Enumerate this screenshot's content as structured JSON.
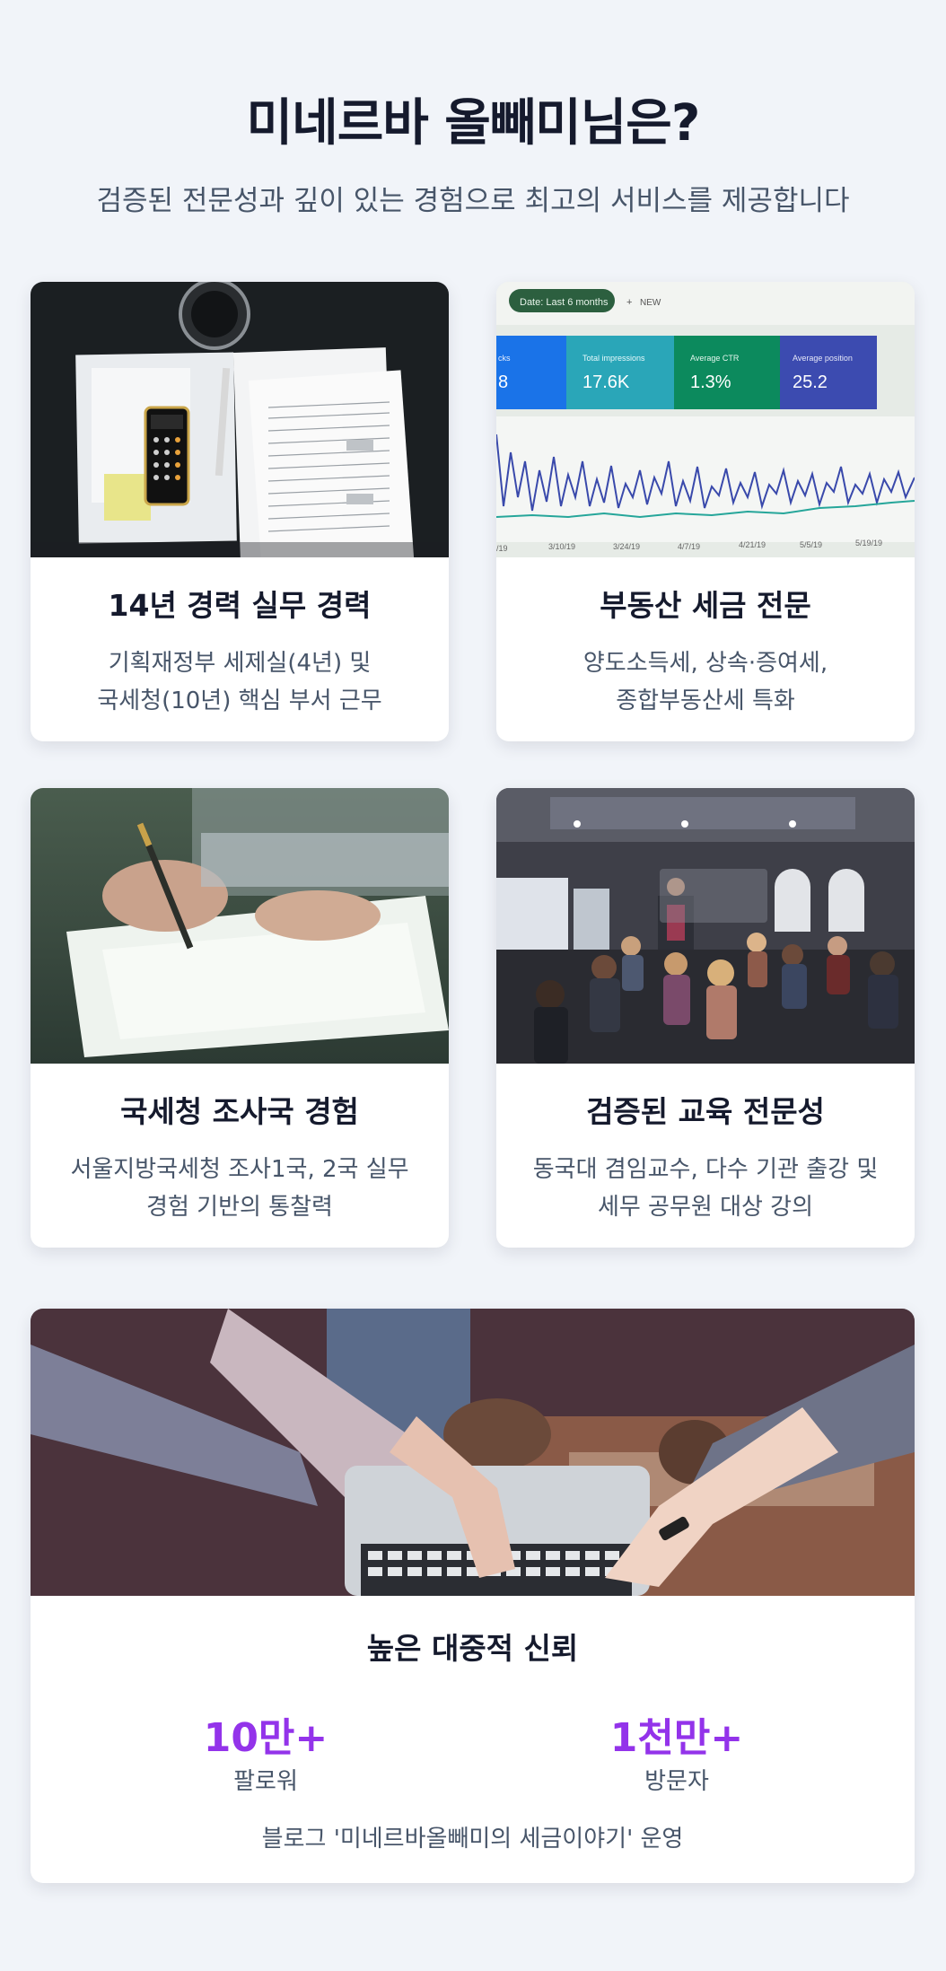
{
  "header": {
    "title": "미네르바 올빼미님은?",
    "subtitle": "검증된 전문성과 깊이 있는 경험으로 최고의 서비스를 제공합니다"
  },
  "cards": [
    {
      "title": "14년 경력 실무 경력",
      "desc_line1": "기획재정부 세제실(4년) 및",
      "desc_line2": "국세청(10년) 핵심 부서 근무",
      "image": "tax-documents-photo"
    },
    {
      "title": "부동산 세금 전문",
      "desc_line1": "양도소득세, 상속·증여세,",
      "desc_line2": "종합부동산세 특화",
      "image": "analytics-dashboard-photo",
      "dashboard": {
        "filter": "Date: Last 6 months",
        "new": "NEW",
        "m1_label": "Total impressions",
        "m1_value": "17.6K",
        "m2_label": "Average CTR",
        "m2_value": "1.3%",
        "m3_label": "Average position",
        "m3_value": "25.2",
        "m0_label": "cks",
        "m0_value": "8",
        "dates": [
          "/19",
          "3/10/19",
          "3/24/19",
          "4/7/19",
          "4/21/19",
          "5/5/19",
          "5/19/19"
        ]
      }
    },
    {
      "title": "국세청 조사국 경험",
      "desc_line1": "서울지방국세청 조사1국, 2국 실무",
      "desc_line2": "경험 기반의 통찰력",
      "image": "signing-document-photo"
    },
    {
      "title": "검증된 교육 전문성",
      "desc_line1": "동국대 겸임교수, 다수 기관 출강 및",
      "desc_line2": "세무 공무원 대상 강의",
      "image": "lecture-room-photo"
    }
  ],
  "trust": {
    "title": "높은 대중적 신뢰",
    "image": "laptop-hands-photo",
    "stats": [
      {
        "value": "10만+",
        "label": "팔로워"
      },
      {
        "value": "1천만+",
        "label": "방문자"
      }
    ],
    "blog": "블로그 '미네르바올빼미의 세금이야기' 운영"
  },
  "colors": {
    "accent": "#9333ea",
    "background": "#f1f4f9",
    "heading": "#151a2d",
    "body": "#475569"
  }
}
